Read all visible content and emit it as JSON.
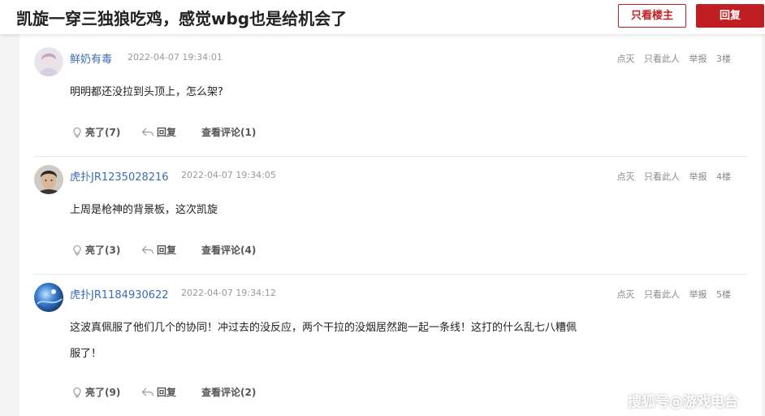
{
  "header": {
    "title": "凯旋一穿三独狼吃鸡，感觉wbg也是给机会了",
    "only_op_label": "只看楼主",
    "reply_label": "回复"
  },
  "posts": [
    {
      "username": "鲜奶有毒",
      "time": "2022-04-07 19:34:01",
      "dislike": "点灭",
      "only_this": "只看此人",
      "report": "举报",
      "floor": "3楼",
      "content_lines": [
        "明明都还没拉到头顶上，怎么架?"
      ],
      "likes": "亮了(7)",
      "reply": "回复",
      "comments": "查看评论(1)"
    },
    {
      "username": "虎扑JR1235028216",
      "time": "2022-04-07 19:34:05",
      "dislike": "点灭",
      "only_this": "只看此人",
      "report": "举报",
      "floor": "4楼",
      "content_lines": [
        "上周是枪神的背景板，这次凯旋"
      ],
      "likes": "亮了(3)",
      "reply": "回复",
      "comments": "查看评论(4)"
    },
    {
      "username": "虎扑JR1184930622",
      "time": "2022-04-07 19:34:12",
      "dislike": "点灭",
      "only_this": "只看此人",
      "report": "举报",
      "floor": "5楼",
      "content_lines": [
        "这波真佩服了他们几个的协同！冲过去的没反应，两个干拉的没烟居然跑一起一条线！这打的什么乱七八糟佩",
        "服了！"
      ],
      "likes": "亮了(9)",
      "reply": "回复",
      "comments": "查看评论(2)"
    }
  ],
  "watermark": "搜狐号@游戏电台"
}
